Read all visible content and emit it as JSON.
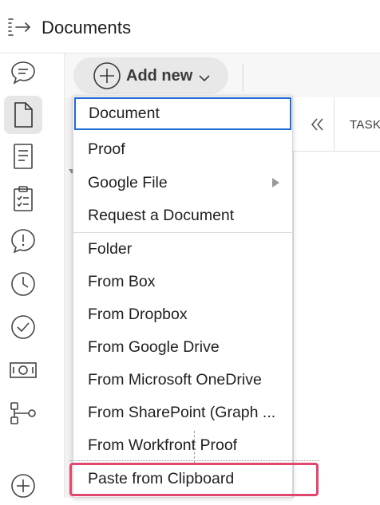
{
  "header": {
    "title": "Documents"
  },
  "toolbar": {
    "add_new_label": "Add new"
  },
  "panel": {
    "column_label": "TASK"
  },
  "menu": {
    "items": [
      {
        "label": "Document"
      },
      {
        "label": "Proof"
      },
      {
        "label": "Google File"
      },
      {
        "label": "Request a Document"
      },
      {
        "label": "Folder"
      },
      {
        "label": "From Box"
      },
      {
        "label": "From Dropbox"
      },
      {
        "label": "From Google Drive"
      },
      {
        "label": "From Microsoft OneDrive"
      },
      {
        "label": "From SharePoint (Graph ..."
      },
      {
        "label": "From Workfront Proof"
      },
      {
        "label": "Paste from Clipboard"
      }
    ]
  },
  "colors": {
    "focus_border": "#1f6bd6",
    "highlight": "#e0476f"
  },
  "rail": {
    "icons": [
      "comment-icon",
      "document-icon",
      "text-document-icon",
      "clipboard-checklist-icon",
      "alert-bubble-icon",
      "clock-icon",
      "checkmark-circle-icon",
      "money-icon",
      "workflow-icon",
      "add-circle-icon"
    ]
  }
}
